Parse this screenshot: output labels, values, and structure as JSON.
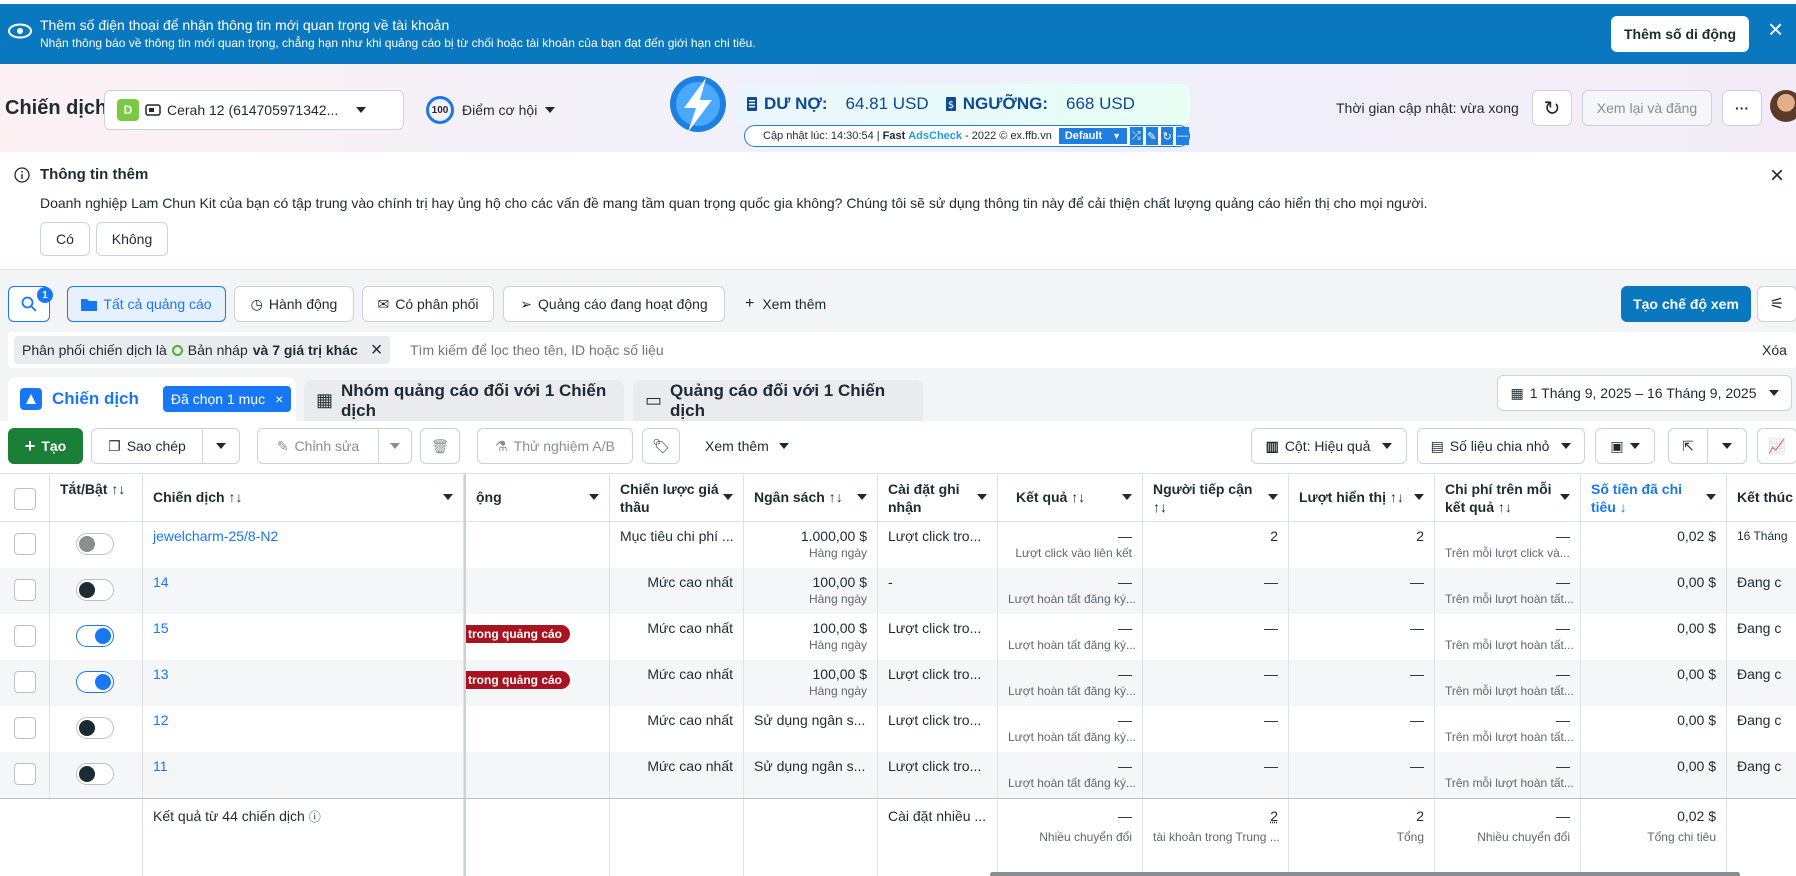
{
  "banner": {
    "title": "Thêm số điện thoại để nhận thông tin mới quan trọng về tài khoản",
    "subtitle": "Nhận thông báo về thông tin mới quan trọng, chẳng hạn như khi quảng cáo bị từ chối hoặc tài khoản của bạn đạt đến giới hạn chi tiêu.",
    "button": "Thêm số di động",
    "close": "×"
  },
  "header": {
    "title": "Chiến dịch",
    "account_badge": "D",
    "account_name": "Cerah 12 (614705971342...",
    "score": "100",
    "score_label": "Điểm cơ hội",
    "update_time": "Thời gian cập nhật: vừa xong",
    "review_button": "Xem lại và đăng",
    "more": "···"
  },
  "adscheck": {
    "debt_label": "DƯ NỢ:",
    "debt_value": "64.81 USD",
    "threshold_label": "NGƯỠNG:",
    "threshold_value": "668 USD",
    "updated": "Cập nhật lúc: 14:30:54 |",
    "fast": "Fast",
    "brand": "AdsCheck",
    "suffix": "- 2022 © ex.ffb.vn",
    "mode": "Default"
  },
  "info": {
    "title": "Thông tin thêm",
    "text": "Doanh nghiệp Lam Chun Kit của bạn có tập trung vào chính trị hay ủng hộ cho các vấn đề mang tầm quan trọng quốc gia không? Chúng tôi sẽ sử dụng thông tin này để cải thiện chất lượng quảng cáo hiển thị cho mọi người.",
    "yes": "Có",
    "no": "Không"
  },
  "filters": {
    "search_count": "1",
    "all_ads": "Tất cả quảng cáo",
    "actions": "Hành động",
    "delivery": "Có phân phối",
    "active_ads": "Quảng cáo đang hoạt động",
    "see_more": "Xem thêm",
    "create_view": "Tạo chế độ xem",
    "chip_prefix": "Phân phối chiến dịch là",
    "chip_value": "Bản nháp",
    "chip_more": "và 7 giá trị khác",
    "search_placeholder": "Tìm kiếm để lọc theo tên, ID hoặc số liệu",
    "clear": "Xóa"
  },
  "tabs": {
    "campaign": "Chiến dịch",
    "selected": "Đã chọn 1 mục",
    "adsets": "Nhóm quảng cáo đối với 1 Chiến dịch",
    "ads": "Quảng cáo đối với 1 Chiến dịch",
    "date_range": "1 Tháng 9, 2025 – 16 Tháng 9, 2025"
  },
  "toolbar": {
    "create": "Tạo",
    "duplicate": "Sao chép",
    "edit": "Chỉnh sửa",
    "ab_test": "Thử nghiệm A/B",
    "see_more": "Xem thêm",
    "columns": "Cột: Hiệu quả",
    "breakdown": "Số liệu chia nhỏ"
  },
  "columns": {
    "toggle": "Tắt/Bật ↑↓",
    "campaign": "Chiến dịch ↑↓",
    "delivery": "ộng",
    "bid": "Chiến lược giá thầu",
    "budget": "Ngân sách ↑↓",
    "attribution": "Cài đặt ghi nhận",
    "results": "Kết quả ↑↓",
    "reach": "Người tiếp cận ↑↓",
    "impressions": "Lượt hiển thị ↑↓",
    "cpr": "Chi phí trên mỗi kết quả ↑↓",
    "spent": "Số tiền đã chi tiêu ↓",
    "end": "Kết thúc"
  },
  "rows": [
    {
      "name": "jewelcharm-25/8-N2",
      "delivery": "",
      "bid": "Mục tiêu chi phí ...",
      "budget": "1.000,00 $",
      "budget_sub": "Hàng ngày",
      "attribution": "Lượt click tro...",
      "results": "—",
      "results_sub": "Lượt click vào liên kết",
      "reach": "2",
      "impressions": "2",
      "cpr": "—",
      "cpr_sub": "Trên mỗi lượt click và...",
      "spent": "0,02 $",
      "end": "16 Tháng"
    },
    {
      "name": "14",
      "delivery": "",
      "bid": "Mức cao nhất",
      "budget": "100,00 $",
      "budget_sub": "Hàng ngày",
      "attribution": "-",
      "results": "—",
      "results_sub": "Lượt hoàn tất đăng ký...",
      "reach": "—",
      "impressions": "—",
      "cpr": "—",
      "cpr_sub": "Trên mỗi lượt hoàn tất...",
      "spent": "0,00 $",
      "end": "Đang c"
    },
    {
      "name": "15",
      "delivery": "trong quảng cáo",
      "bid": "Mức cao nhất",
      "budget": "100,00 $",
      "budget_sub": "Hàng ngày",
      "attribution": "Lượt click tro...",
      "results": "—",
      "results_sub": "Lượt hoàn tất đăng ký...",
      "reach": "—",
      "impressions": "—",
      "cpr": "—",
      "cpr_sub": "Trên mỗi lượt hoàn tất...",
      "spent": "0,00 $",
      "end": "Đang c"
    },
    {
      "name": "13",
      "delivery": "trong quảng cáo",
      "bid": "Mức cao nhất",
      "budget": "100,00 $",
      "budget_sub": "Hàng ngày",
      "attribution": "Lượt click tro...",
      "results": "—",
      "results_sub": "Lượt hoàn tất đăng ký...",
      "reach": "—",
      "impressions": "—",
      "cpr": "—",
      "cpr_sub": "Trên mỗi lượt hoàn tất...",
      "spent": "0,00 $",
      "end": "Đang c"
    },
    {
      "name": "12",
      "delivery": "",
      "bid": "Mức cao nhất",
      "budget": "Sử dụng ngân s...",
      "budget_sub": "",
      "attribution": "Lượt click tro...",
      "results": "—",
      "results_sub": "Lượt hoàn tất đăng ký...",
      "reach": "—",
      "impressions": "—",
      "cpr": "—",
      "cpr_sub": "Trên mỗi lượt hoàn tất...",
      "spent": "0,00 $",
      "end": "Đang c"
    },
    {
      "name": "11",
      "delivery": "",
      "bid": "Mức cao nhất",
      "budget": "Sử dụng ngân s...",
      "budget_sub": "",
      "attribution": "Lượt click tro...",
      "results": "—",
      "results_sub": "Lượt hoàn tất đăng ký...",
      "reach": "—",
      "impressions": "—",
      "cpr": "—",
      "cpr_sub": "Trên mỗi lượt hoàn tất...",
      "spent": "0,00 $",
      "end": "Đang c"
    }
  ],
  "footer": {
    "label": "Kết quả từ 44 chiến dịch",
    "attribution": "Cài đặt nhiều ...",
    "results": "—",
    "results_sub": "Nhiều chuyển đổi",
    "reach": "2",
    "reach_sub": "tài khoản trong Trung ...",
    "impressions": "2",
    "impressions_sub": "Tổng",
    "cpr": "—",
    "cpr_sub": "Nhiều chuyển đổi",
    "spent": "0,02 $",
    "spent_sub": "Tổng chi tiêu"
  }
}
